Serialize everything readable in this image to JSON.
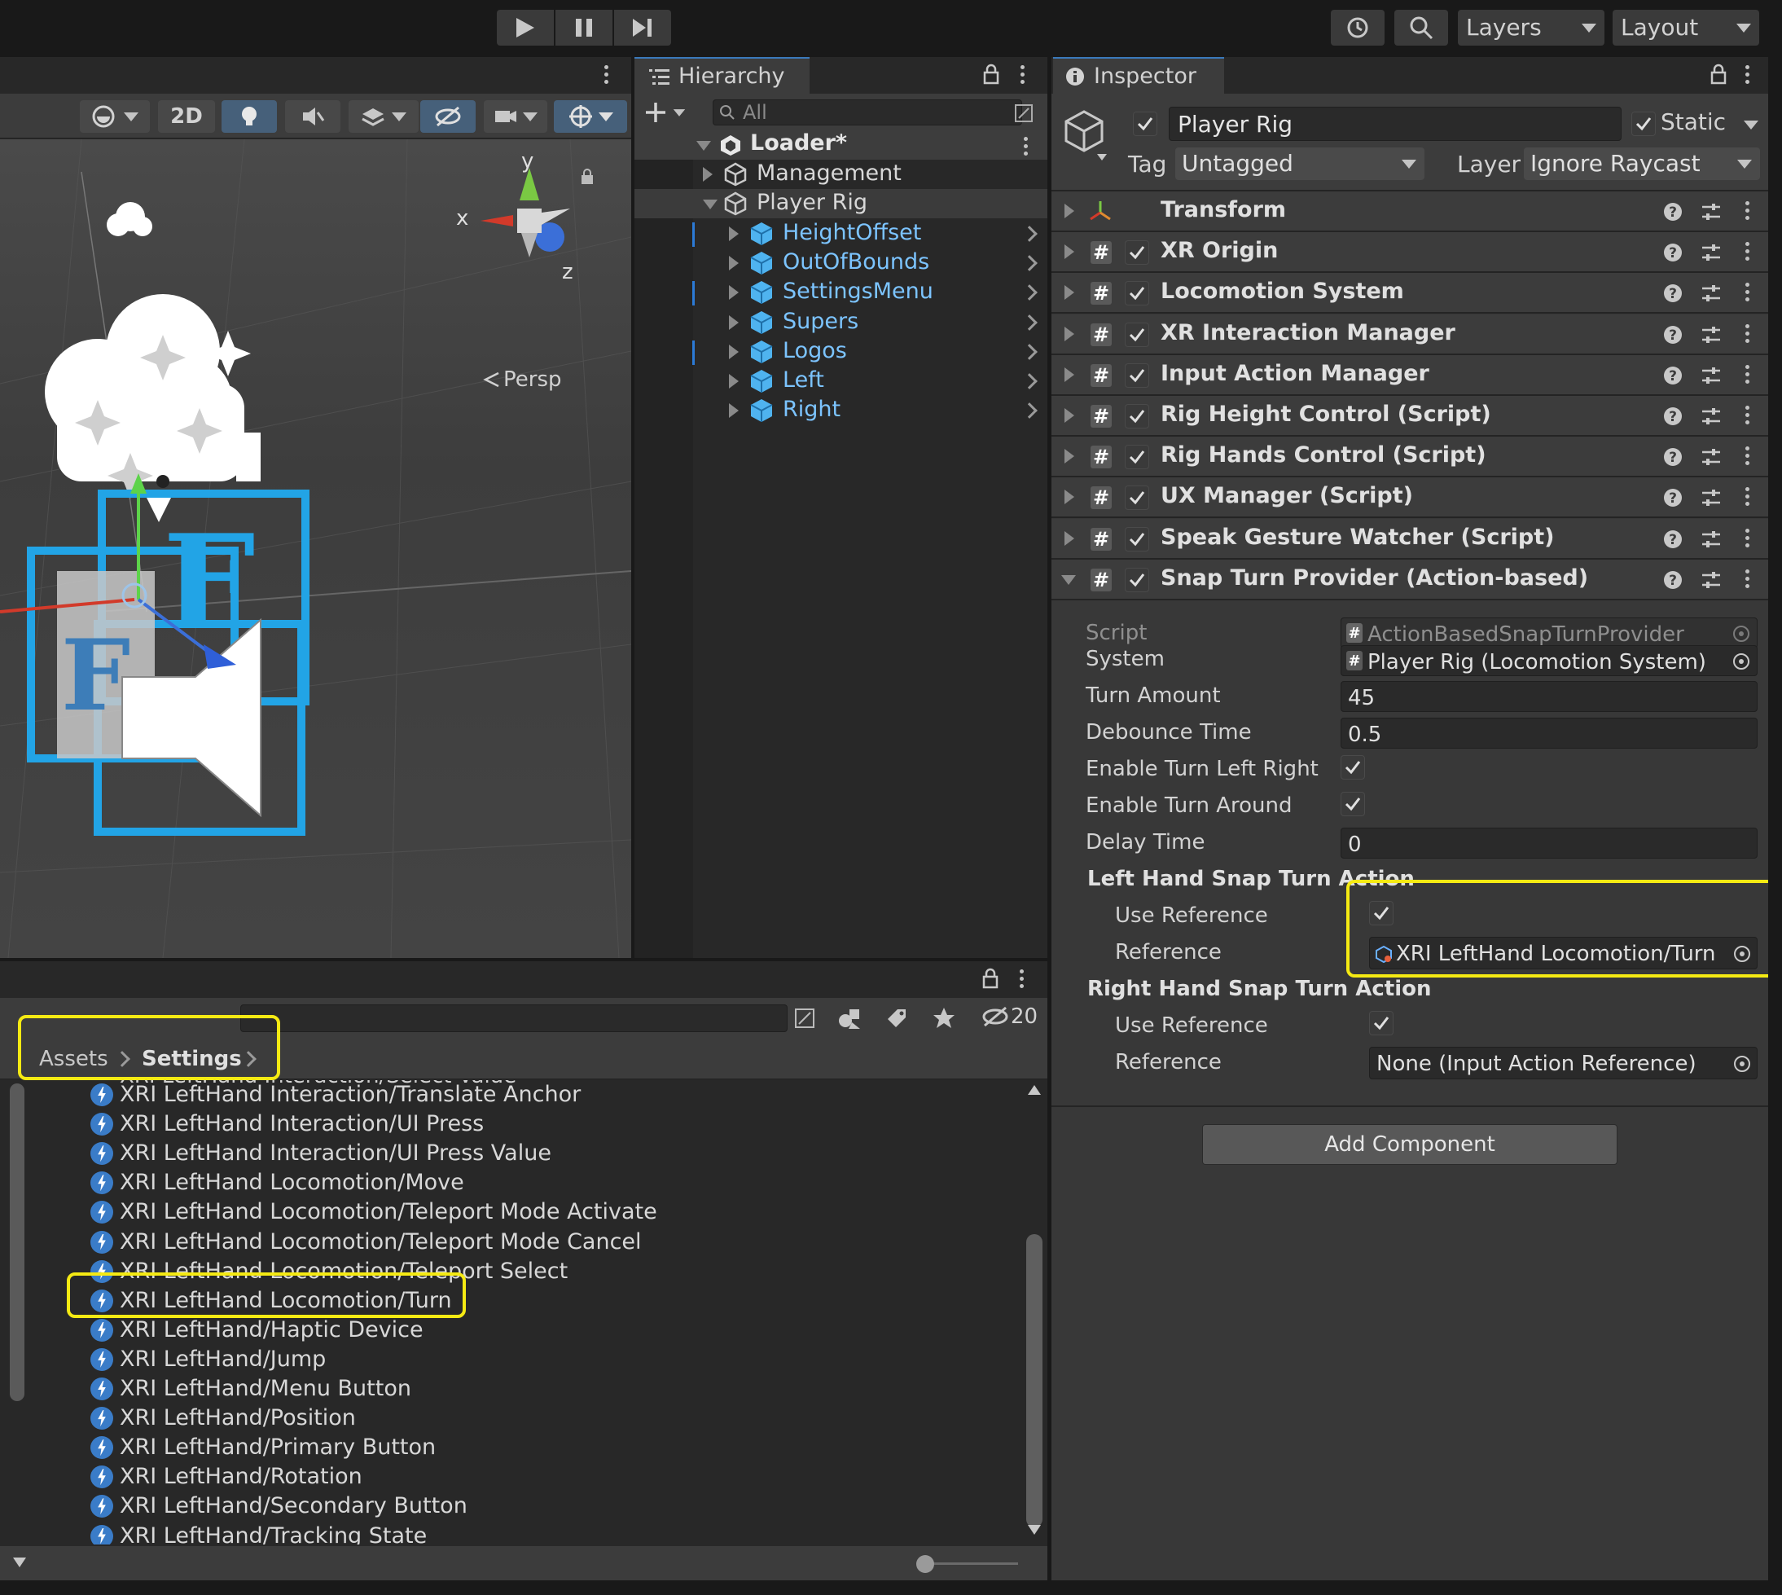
{
  "toolbar": {
    "layers_label": "Layers",
    "layout_label": "Layout"
  },
  "scene": {
    "btn_2d": "2D",
    "persp_label": "Persp",
    "axis_x": "x",
    "axis_y": "y",
    "axis_z": "z"
  },
  "hierarchy": {
    "tab_label": "Hierarchy",
    "search_placeholder": "All",
    "root": "Loader*",
    "items": [
      {
        "label": "Management",
        "depth": 1,
        "expanded": false,
        "prefab": false
      },
      {
        "label": "Player Rig",
        "depth": 1,
        "expanded": true,
        "prefab": false
      },
      {
        "label": "HeightOffset",
        "depth": 2,
        "expanded": false,
        "prefab": true
      },
      {
        "label": "OutOfBounds",
        "depth": 2,
        "expanded": false,
        "prefab": true
      },
      {
        "label": "SettingsMenu",
        "depth": 2,
        "expanded": false,
        "prefab": true
      },
      {
        "label": "Supers",
        "depth": 2,
        "expanded": false,
        "prefab": true
      },
      {
        "label": "Logos",
        "depth": 2,
        "expanded": false,
        "prefab": true
      },
      {
        "label": "Left",
        "depth": 2,
        "expanded": false,
        "prefab": true
      },
      {
        "label": "Right",
        "depth": 2,
        "expanded": false,
        "prefab": true
      }
    ]
  },
  "inspector": {
    "tab_label": "Inspector",
    "object_name": "Player Rig",
    "static_label": "Static",
    "tag_label": "Tag",
    "tag_value": "Untagged",
    "layer_label": "Layer",
    "layer_value": "Ignore Raycast",
    "components": [
      {
        "name": "Transform",
        "checkbox": false,
        "expanded": false
      },
      {
        "name": "XR Origin",
        "checkbox": true,
        "expanded": false
      },
      {
        "name": "Locomotion System",
        "checkbox": true,
        "expanded": false
      },
      {
        "name": "XR Interaction Manager",
        "checkbox": true,
        "expanded": false
      },
      {
        "name": "Input Action Manager",
        "checkbox": true,
        "expanded": false
      },
      {
        "name": "Rig Height Control (Script)",
        "checkbox": true,
        "expanded": false
      },
      {
        "name": "Rig Hands Control (Script)",
        "checkbox": true,
        "expanded": false
      },
      {
        "name": "UX Manager (Script)",
        "checkbox": true,
        "expanded": false
      },
      {
        "name": "Speak Gesture Watcher (Script)",
        "checkbox": true,
        "expanded": false
      },
      {
        "name": "Snap Turn Provider (Action-based)",
        "checkbox": true,
        "expanded": true
      }
    ],
    "props": {
      "script_label": "Script",
      "script_value": "ActionBasedSnapTurnProvider",
      "system_label": "System",
      "system_value": "Player Rig (Locomotion System)",
      "turn_amount_label": "Turn Amount",
      "turn_amount_value": "45",
      "debounce_label": "Debounce Time",
      "debounce_value": "0.5",
      "enable_lr_label": "Enable Turn Left Right",
      "enable_around_label": "Enable Turn Around",
      "delay_label": "Delay Time",
      "delay_value": "0",
      "left_header": "Left Hand Snap Turn Action",
      "right_header": "Right Hand Snap Turn Action",
      "use_ref_label": "Use Reference",
      "reference_label": "Reference",
      "left_reference_value": "XRI LeftHand Locomotion/Turn",
      "right_reference_value": "None (Input Action Reference)"
    },
    "add_component": "Add Component"
  },
  "project": {
    "breadcrumb_root": "Assets",
    "breadcrumb_current": "Settings",
    "hidden_count": "20",
    "clipped_top": "XRI LeftHand Interaction/Select Value",
    "assets": [
      "XRI LeftHand Interaction/Translate Anchor",
      "XRI LeftHand Interaction/UI Press",
      "XRI LeftHand Interaction/UI Press Value",
      "XRI LeftHand Locomotion/Move",
      "XRI LeftHand Locomotion/Teleport Mode Activate",
      "XRI LeftHand Locomotion/Teleport Mode Cancel",
      "XRI LeftHand Locomotion/Teleport Select",
      "XRI LeftHand Locomotion/Turn",
      "XRI LeftHand/Haptic Device",
      "XRI LeftHand/Jump",
      "XRI LeftHand/Menu Button",
      "XRI LeftHand/Position",
      "XRI LeftHand/Primary Button",
      "XRI LeftHand/Rotation",
      "XRI LeftHand/Secondary Button",
      "XRI LeftHand/Tracking State"
    ]
  },
  "colors": {
    "highlight": "#f5ea13",
    "prefab_blue": "#7cc4ff",
    "selected_row": "#3b3b3b"
  }
}
